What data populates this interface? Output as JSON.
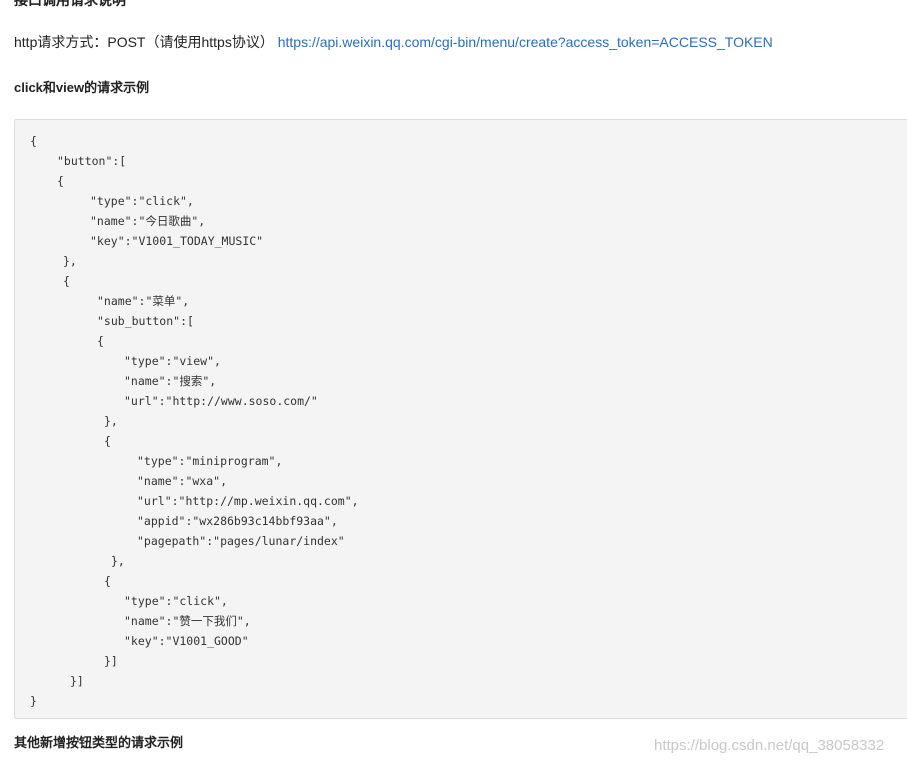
{
  "top_heading": "接口调用请求说明",
  "http_method_text": "http请求方式：POST（请使用https协议）",
  "api_url": "https://api.weixin.qq.com/cgi-bin/menu/create?access_token=ACCESS_TOKEN",
  "example_heading": "click和view的请求示例",
  "code_lines": [
    "{",
    "\"button\":[",
    "{",
    "\"type\":\"click\",",
    "\"name\":\"今日歌曲\",",
    "\"key\":\"V1001_TODAY_MUSIC\"",
    "},",
    "{",
    "\"name\":\"菜单\",",
    "\"sub_button\":[",
    "{",
    "\"type\":\"view\",",
    "\"name\":\"搜索\",",
    "\"url\":\"http://www.soso.com/\"",
    "},",
    "{",
    "\"type\":\"miniprogram\",",
    "\"name\":\"wxa\",",
    "\"url\":\"http://mp.weixin.qq.com\",",
    "\"appid\":\"wx286b93c14bbf93aa\",",
    "\"pagepath\":\"pages/lunar/index\"",
    "},",
    "{",
    "\"type\":\"click\",",
    "\"name\":\"赞一下我们\",",
    "\"key\":\"V1001_GOOD\"",
    "}]",
    "}]",
    "}"
  ],
  "other_heading": "其他新增按钮类型的请求示例",
  "watermark": "https://blog.csdn.net/qq_38058332"
}
